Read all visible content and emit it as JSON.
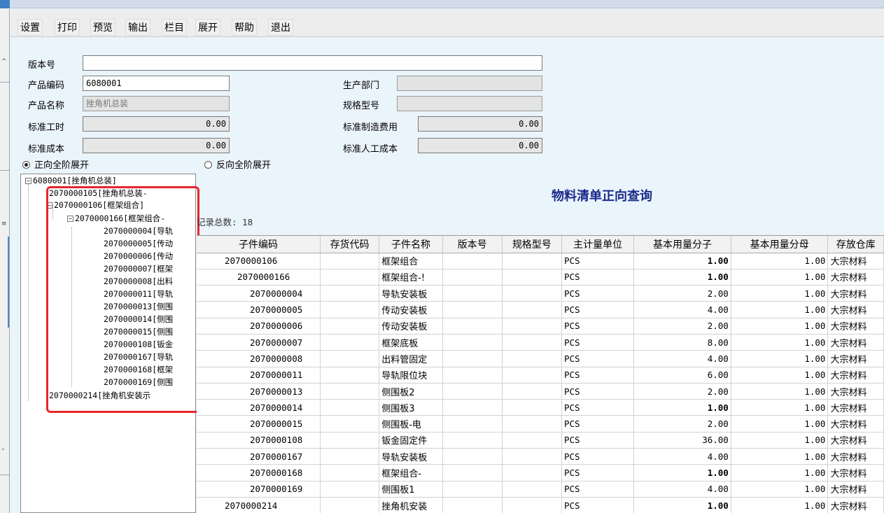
{
  "menu": [
    "设置",
    "打印",
    "预览",
    "输出",
    "栏目",
    "展开",
    "帮助",
    "退出"
  ],
  "form": {
    "version_label": "版本号",
    "version_value": "",
    "product_code_label": "产品编码",
    "product_code_value": "6080001",
    "department_label": "生产部门",
    "department_value": "",
    "product_name_label": "产品名称",
    "product_name_value": "挫角机总装",
    "spec_label": "规格型号",
    "spec_value": "",
    "std_hours_label": "标准工时",
    "std_hours_value": "0.00",
    "std_mfg_cost_label": "标准制造费用",
    "std_mfg_cost_value": "0.00",
    "std_cost_label": "标准成本",
    "std_cost_value": "0.00",
    "std_labor_cost_label": "标准人工成本",
    "std_labor_cost_value": "0.00"
  },
  "radio": {
    "forward_label": "正向全阶展开",
    "reverse_label": "反向全阶展开",
    "selected": "forward"
  },
  "tree": {
    "root": "6080001[挫角机总装]",
    "nodes": [
      "2070000105[挫角机总装-",
      "2070000106[框架组合]",
      "2070000166[框架组合-",
      "2070000004[导轨",
      "2070000005[传动",
      "2070000006[传动",
      "2070000007[框架",
      "2070000008[出料",
      "2070000011[导轨",
      "2070000013[侧围",
      "2070000014[侧围",
      "2070000015[侧围",
      "2070000108[钣金",
      "2070000167[导轨",
      "2070000168[框架",
      "2070000169[侧围",
      "2070000214[挫角机安装示"
    ]
  },
  "report": {
    "title": "物料清单正向查询",
    "record_count": "记录总数: 18"
  },
  "grid": {
    "headers": [
      "子件编码",
      "存货代码",
      "子件名称",
      "版本号",
      "规格型号",
      "主计量单位",
      "基本用量分子",
      "基本用量分母",
      "存放仓库"
    ],
    "rows": [
      {
        "code": "2070000106",
        "level": 0,
        "name": "框架组合",
        "unit": "PCS",
        "num": "1.00",
        "den": "1.00",
        "wh": "大宗材料"
      },
      {
        "code": "2070000166",
        "level": 1,
        "name": "框架组合-!",
        "unit": "PCS",
        "num": "1.00",
        "den": "1.00",
        "wh": "大宗材料"
      },
      {
        "code": "2070000004",
        "level": 2,
        "name": "导轨安装板",
        "unit": "PCS",
        "num": "2.00",
        "den": "1.00",
        "wh": "大宗材料"
      },
      {
        "code": "2070000005",
        "level": 2,
        "name": "传动安装板",
        "unit": "PCS",
        "num": "4.00",
        "den": "1.00",
        "wh": "大宗材料"
      },
      {
        "code": "2070000006",
        "level": 2,
        "name": "传动安装板",
        "unit": "PCS",
        "num": "2.00",
        "den": "1.00",
        "wh": "大宗材料"
      },
      {
        "code": "2070000007",
        "level": 2,
        "name": "框架底板",
        "unit": "PCS",
        "num": "8.00",
        "den": "1.00",
        "wh": "大宗材料"
      },
      {
        "code": "2070000008",
        "level": 2,
        "name": "出料管固定",
        "unit": "PCS",
        "num": "4.00",
        "den": "1.00",
        "wh": "大宗材料"
      },
      {
        "code": "2070000011",
        "level": 2,
        "name": "导轨限位块",
        "unit": "PCS",
        "num": "6.00",
        "den": "1.00",
        "wh": "大宗材料"
      },
      {
        "code": "2070000013",
        "level": 2,
        "name": "侧围板2",
        "unit": "PCS",
        "num": "2.00",
        "den": "1.00",
        "wh": "大宗材料"
      },
      {
        "code": "2070000014",
        "level": 2,
        "name": "侧围板3",
        "unit": "PCS",
        "num": "1.00",
        "den": "1.00",
        "wh": "大宗材料"
      },
      {
        "code": "2070000015",
        "level": 2,
        "name": "侧围板-电",
        "unit": "PCS",
        "num": "2.00",
        "den": "1.00",
        "wh": "大宗材料"
      },
      {
        "code": "2070000108",
        "level": 2,
        "name": "钣金固定件",
        "unit": "PCS",
        "num": "36.00",
        "den": "1.00",
        "wh": "大宗材料"
      },
      {
        "code": "2070000167",
        "level": 2,
        "name": "导轨安装板",
        "unit": "PCS",
        "num": "4.00",
        "den": "1.00",
        "wh": "大宗材料"
      },
      {
        "code": "2070000168",
        "level": 2,
        "name": "框架组合-",
        "unit": "PCS",
        "num": "1.00",
        "den": "1.00",
        "wh": "大宗材料"
      },
      {
        "code": "2070000169",
        "level": 2,
        "name": "侧围板1",
        "unit": "PCS",
        "num": "4.00",
        "den": "1.00",
        "wh": "大宗材料"
      },
      {
        "code": "2070000214",
        "level": 0,
        "name": "挫角机安装",
        "unit": "PCS",
        "num": "1.00",
        "den": "1.00",
        "wh": "大宗材料"
      }
    ]
  }
}
